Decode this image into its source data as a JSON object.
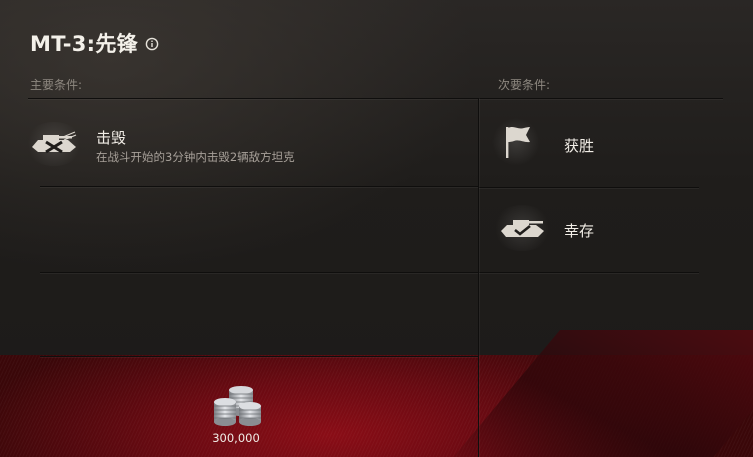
{
  "header": {
    "title": "MT-3:先锋",
    "info_icon": "info-circle-icon"
  },
  "primary": {
    "label": "主要条件:",
    "conditions": [
      {
        "icon": "destroy-tank-icon",
        "title": "击毁",
        "description": "在战斗开始的3分钟内击毁2辆敌方坦克"
      }
    ]
  },
  "secondary": {
    "label": "次要条件:",
    "conditions": [
      {
        "icon": "victory-flag-icon",
        "title": "获胜"
      },
      {
        "icon": "survive-tank-icon",
        "title": "幸存"
      }
    ]
  },
  "reward": {
    "icon": "silver-coins-icon",
    "amount": "300,000"
  },
  "colors": {
    "background": "#1f1d1b",
    "accent_red": "#8a0d16",
    "text_primary": "#f1ede6",
    "text_muted": "#8e8880"
  }
}
